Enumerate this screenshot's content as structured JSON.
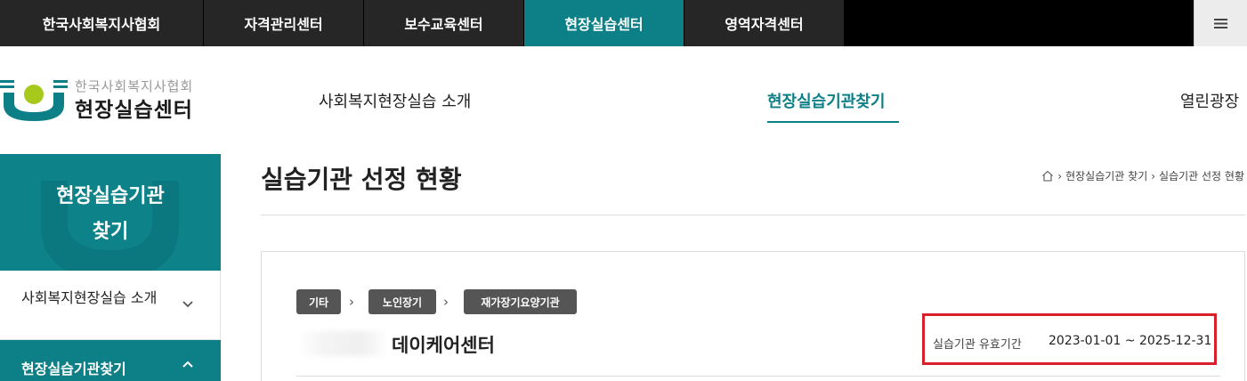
{
  "topbar": {
    "tabs": [
      "한국사회복지사협회",
      "자격관리센터",
      "보수교육센터",
      "현장실습센터",
      "영역자격센터"
    ],
    "active_tab": "현장실습센터",
    "menu_icon": "≡"
  },
  "header": {
    "logo_sub": "한국사회복지사협회",
    "logo_main": "현장실습센터",
    "nav": [
      "사회복지현장실습 소개",
      "현장실습기관찾기",
      "열린광장"
    ],
    "active_nav": "현장실습기관찾기"
  },
  "sidebar": {
    "title_line1": "현장실습기관",
    "title_line2": "찾기",
    "items": [
      {
        "label": "사회복지현장실습 소개",
        "icon": "chevron-down-icon"
      },
      {
        "label": "현장실습기관찾기",
        "icon": "chevron-up-icon"
      }
    ]
  },
  "main": {
    "page_title": "실습기관 선정 현황",
    "breadcrumb": [
      "현장실습기관 찾기",
      "실습기관 선정 현황"
    ],
    "categories": [
      "기타",
      "노인장기",
      "재가장기요양기관"
    ],
    "institution_name": "데이케어센터",
    "period_label": "실습기관 유효기간",
    "period_value": "2023-01-01 ~ 2025-12-31"
  },
  "colors": {
    "accent": "#0d7f86",
    "topbar_bg": "#262626",
    "highlight_border": "#d8202a"
  }
}
